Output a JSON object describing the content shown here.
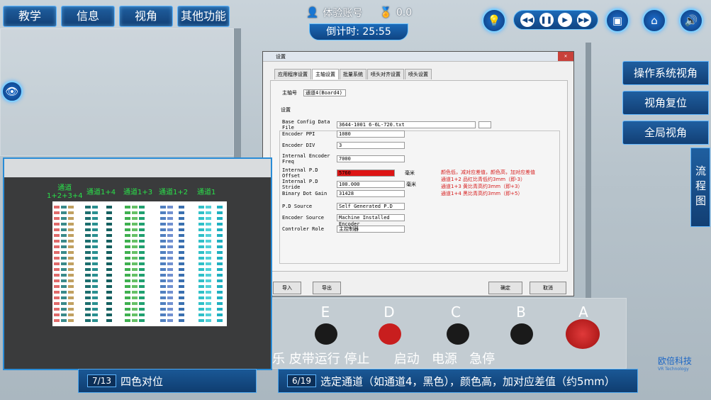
{
  "menu": [
    "教学",
    "信息",
    "视角",
    "其他功能"
  ],
  "account": {
    "label": "体验账号",
    "score": "0.0"
  },
  "timer": "倒计时: 25:55",
  "side_buttons": [
    "操作系统视角",
    "视角复位",
    "全局视角"
  ],
  "flow_button": "流程图",
  "dialog": {
    "title": "设置",
    "close": "✕",
    "tabs": [
      "应用程序设置",
      "主轴设置",
      "批量系统",
      "喷头对齐设置",
      "喷头设置"
    ],
    "spindle_label": "主轴号",
    "spindle_value": "通道4(Board4)",
    "group_label": "设置",
    "rows": [
      {
        "label": "Base Config Data File",
        "value": "3644-1001 6-6L-720.txt"
      },
      {
        "label": "Encoder PPI",
        "value": "1080"
      },
      {
        "label": "Encoder DIV",
        "value": "3"
      },
      {
        "label": "Internal Encoder Freq",
        "value": "7000"
      },
      {
        "label": "Internal P.D Offset",
        "value": "5760"
      },
      {
        "label": "Internal P.D Stride",
        "value": "100.000"
      },
      {
        "label": "Binary Dot Gain",
        "value": "31428"
      },
      {
        "label": "P.D Source",
        "value": "Self Generated P.D"
      },
      {
        "label": "Encoder Source",
        "value": "Machine Installed Encoder"
      },
      {
        "label": "Controler Role",
        "value": "主控制器"
      }
    ],
    "unit": "毫米",
    "notes": [
      "颜色低，减对应差值，颜色高，加对应差值",
      "通道1+2    品红比青低约3mm（即-3）",
      "通道1+3    黄比青高约3mm（即+3）",
      "通道1+4    黑比青高约3mm（即+5）"
    ],
    "btn_import": "导入",
    "btn_export": "导出",
    "btn_ok": "确定",
    "btn_cancel": "取消"
  },
  "inset": {
    "channels": [
      "通道\n1+2+3+4",
      "通道1+4",
      "通道1+3",
      "通道1+2",
      "通道1"
    ]
  },
  "panel": {
    "letters": [
      "E",
      "D",
      "C",
      "B",
      "A"
    ],
    "text": "乐 皮带运行 停止      启动   电源   急停"
  },
  "steps": [
    {
      "num": "7/13",
      "text": "四色对位"
    },
    {
      "num": "6/19",
      "text": "选定通道（如通道4，黑色），颜色高，加对应差值（约5mm）"
    }
  ],
  "brand": {
    "name": "欧倍科技",
    "sub": "VR Technology"
  }
}
